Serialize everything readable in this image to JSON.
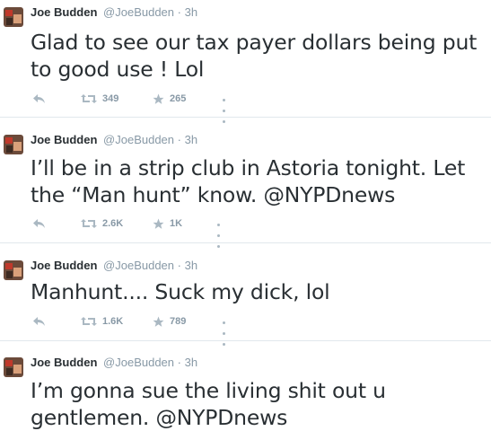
{
  "tweets": [
    {
      "name": "Joe Budden",
      "handle": "@JoeBudden",
      "separator": "·",
      "time": "3h",
      "text": "Glad to see our tax payer dollars being put to good use ! Lol",
      "retweets": "349",
      "favorites": "265"
    },
    {
      "name": "Joe Budden",
      "handle": "@JoeBudden",
      "separator": "·",
      "time": "3h",
      "text": "I’ll be in a strip club in Astoria tonight. Let the “Man hunt” know. @NYPDnews",
      "retweets": "2.6K",
      "favorites": "1K"
    },
    {
      "name": "Joe Budden",
      "handle": "@JoeBudden",
      "separator": "·",
      "time": "3h",
      "text": "Manhunt.... Suck my dick, lol",
      "retweets": "1.6K",
      "favorites": "789"
    },
    {
      "name": "Joe Budden",
      "handle": "@JoeBudden",
      "separator": "·",
      "time": "3h",
      "text": "I’m gonna sue the living shit out u gentlemen. @NYPDnews",
      "retweets": "",
      "favorites": ""
    }
  ],
  "icons": {
    "reply": "reply-icon",
    "retweet": "retweet-icon",
    "favorite": "star-icon",
    "more": "more-icon"
  },
  "colors": {
    "text": "#292f33",
    "muted": "#8899a6",
    "divider": "#e1e8ed"
  }
}
